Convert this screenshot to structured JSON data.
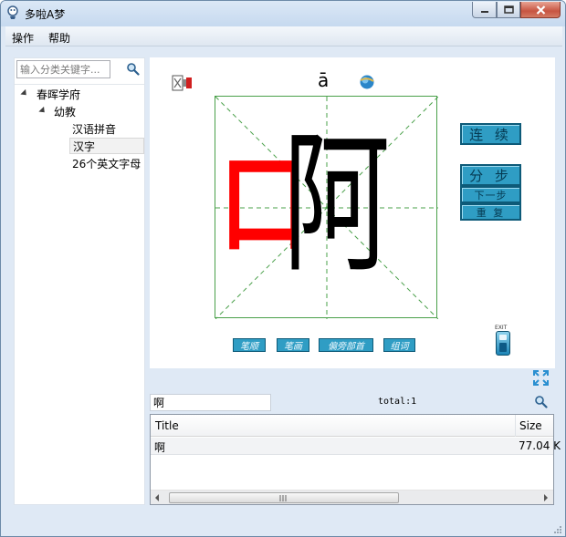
{
  "window": {
    "title": "多啦A梦",
    "controls": [
      "minimize",
      "maximize",
      "close"
    ]
  },
  "menu": {
    "items": [
      "操作",
      "帮助"
    ]
  },
  "sidebar": {
    "search_placeholder": "输入分类关键字...",
    "tree": [
      {
        "label": "春晖学府",
        "level": 0,
        "expanded": true
      },
      {
        "label": "幼教",
        "level": 1,
        "expanded": true
      },
      {
        "label": "汉语拼音",
        "level": 2
      },
      {
        "label": "汉字",
        "level": 2,
        "selected": true
      },
      {
        "label": "26个英文字母",
        "level": 2
      }
    ]
  },
  "viewer": {
    "character": "啊",
    "radical_part": "口",
    "remaining_part": "阿",
    "pinyin": "ā",
    "buttons": {
      "continuous": "连 续",
      "step": "分 步",
      "next": "下一步",
      "repeat": "重 复"
    },
    "bottom_buttons": [
      "笔顺",
      "笔画",
      "偏旁部首",
      "组词"
    ],
    "exit_label": "EXIT",
    "colors": {
      "radical": "#ff0000",
      "rest": "#000000",
      "grid": "#4aa04a",
      "button": "#2f9dc4"
    }
  },
  "results": {
    "search_value": "啊",
    "total_label": "total:1",
    "columns": [
      "Title",
      "Size"
    ],
    "rows": [
      {
        "title": "啊",
        "size": "77.04 K"
      }
    ]
  }
}
